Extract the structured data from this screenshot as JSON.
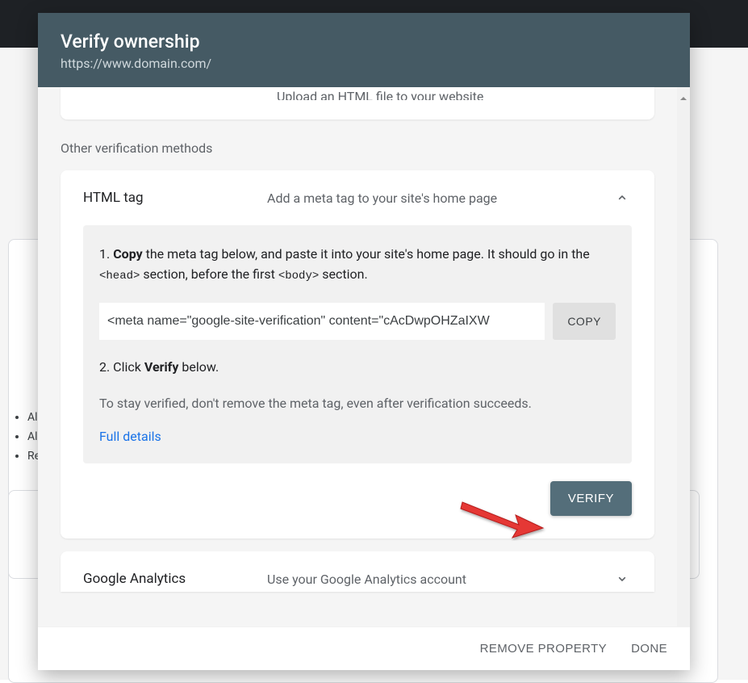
{
  "bg": {
    "list": [
      "All",
      "All",
      "Re"
    ]
  },
  "modal": {
    "title": "Verify ownership",
    "subtitle": "https://www.domain.com/",
    "truncated_method": {
      "desc": "Upload an HTML file to your website"
    },
    "other_label": "Other verification methods",
    "html_tag": {
      "name": "HTML tag",
      "desc": "Add a meta tag to your site's home page",
      "step1_prefix": "1. ",
      "step1_copy": "Copy",
      "step1_text": " the meta tag below, and paste it into your site's home page. It should go in the ",
      "step1_code1": "<head>",
      "step1_mid": " section, before the first ",
      "step1_code2": "<body>",
      "step1_suffix": " section.",
      "meta_tag": "<meta name=\"google-site-verification\" content=\"cAcDwpOHZaIXW",
      "copy_btn": "COPY",
      "step2_prefix": "2. Click ",
      "step2_verify": "Verify",
      "step2_suffix": " below.",
      "stay_text": "To stay verified, don't remove the meta tag, even after verification succeeds.",
      "details": "Full details",
      "verify_btn": "VERIFY"
    },
    "ga": {
      "name": "Google Analytics",
      "desc": "Use your Google Analytics account"
    },
    "footer": {
      "remove": "REMOVE PROPERTY",
      "done": "DONE"
    }
  }
}
